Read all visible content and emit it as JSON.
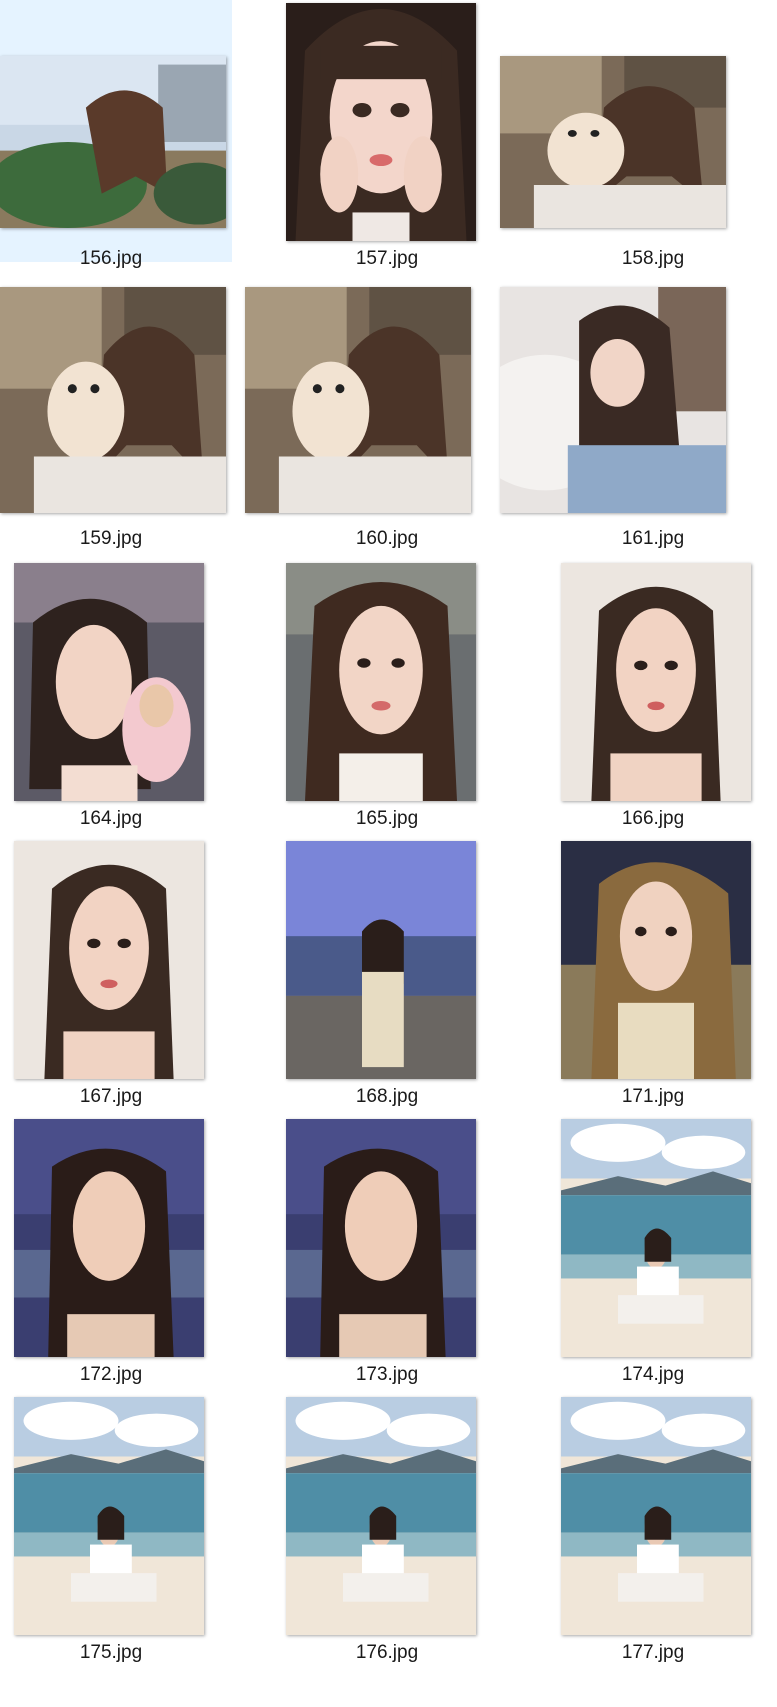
{
  "file_view": {
    "selected_file": "156.jpg",
    "files": [
      {
        "name": "156.jpg",
        "scene": "outdoor-rooftop",
        "orientation": "landscape"
      },
      {
        "name": "157.jpg",
        "scene": "closeup-face",
        "orientation": "portrait"
      },
      {
        "name": "158.jpg",
        "scene": "indoor-puppy",
        "orientation": "landscape"
      },
      {
        "name": "159.jpg",
        "scene": "indoor-puppy",
        "orientation": "landscape"
      },
      {
        "name": "160.jpg",
        "scene": "indoor-puppy",
        "orientation": "landscape"
      },
      {
        "name": "161.jpg",
        "scene": "indoor-bed",
        "orientation": "landscape"
      },
      {
        "name": "164.jpg",
        "scene": "indoor-plush",
        "orientation": "portrait"
      },
      {
        "name": "165.jpg",
        "scene": "indoor-selfie",
        "orientation": "portrait"
      },
      {
        "name": "166.jpg",
        "scene": "wall-selfie",
        "orientation": "portrait"
      },
      {
        "name": "167.jpg",
        "scene": "wall-selfie",
        "orientation": "portrait"
      },
      {
        "name": "168.jpg",
        "scene": "beach-dusk",
        "orientation": "portrait"
      },
      {
        "name": "171.jpg",
        "scene": "night-selfie",
        "orientation": "portrait"
      },
      {
        "name": "172.jpg",
        "scene": "dusk-sea",
        "orientation": "portrait"
      },
      {
        "name": "173.jpg",
        "scene": "dusk-sea",
        "orientation": "portrait"
      },
      {
        "name": "174.jpg",
        "scene": "beach-day",
        "orientation": "portrait"
      },
      {
        "name": "175.jpg",
        "scene": "beach-day",
        "orientation": "portrait"
      },
      {
        "name": "176.jpg",
        "scene": "beach-day",
        "orientation": "portrait"
      },
      {
        "name": "177.jpg",
        "scene": "beach-day",
        "orientation": "portrait"
      }
    ]
  },
  "colors": {
    "selection": "#e5f3ff",
    "caption_text": "#1a1a1a"
  }
}
